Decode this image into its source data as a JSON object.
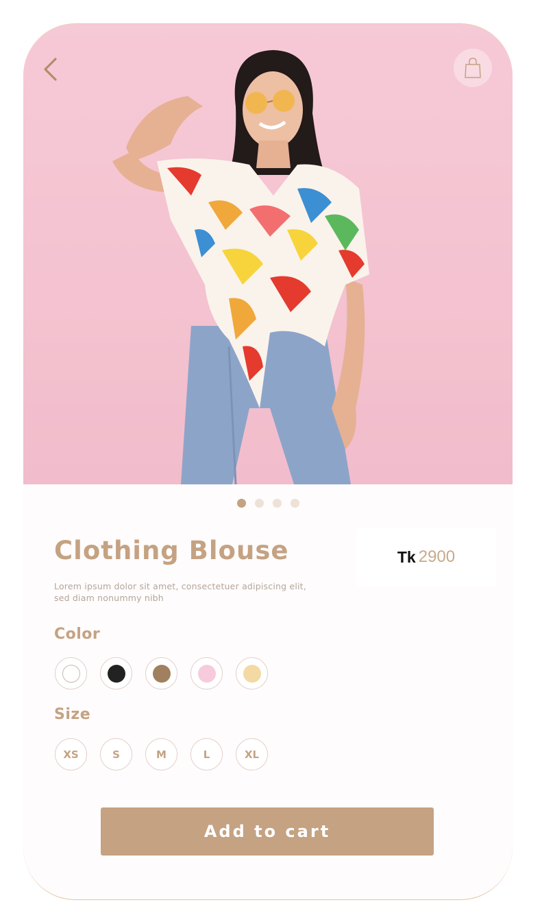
{
  "product": {
    "title": "Clothing Blouse",
    "description": "Lorem ipsum dolor sit amet, consectetuer adipiscing elit, sed diam nonummy nibh",
    "price_currency": "Tk",
    "price_value": "2900"
  },
  "carousel": {
    "count": 4,
    "active_index": 0
  },
  "color_section": {
    "label": "Color",
    "options": [
      {
        "name": "white",
        "hex": "#ffffff"
      },
      {
        "name": "black",
        "hex": "#222222"
      },
      {
        "name": "brown",
        "hex": "#a0805e"
      },
      {
        "name": "pink",
        "hex": "#f7cbdb"
      },
      {
        "name": "cream",
        "hex": "#f3d9a3"
      }
    ]
  },
  "size_section": {
    "label": "Size",
    "options": [
      "XS",
      "S",
      "M",
      "L",
      "XL"
    ]
  },
  "cart_button": {
    "label": "Add to cart"
  },
  "icons": {
    "back": "chevron-left-icon",
    "bag": "shopping-bag-icon"
  },
  "colors": {
    "accent": "#c4a282",
    "hero_background": "#f5c5d3",
    "card_background": "#fefcfc"
  }
}
